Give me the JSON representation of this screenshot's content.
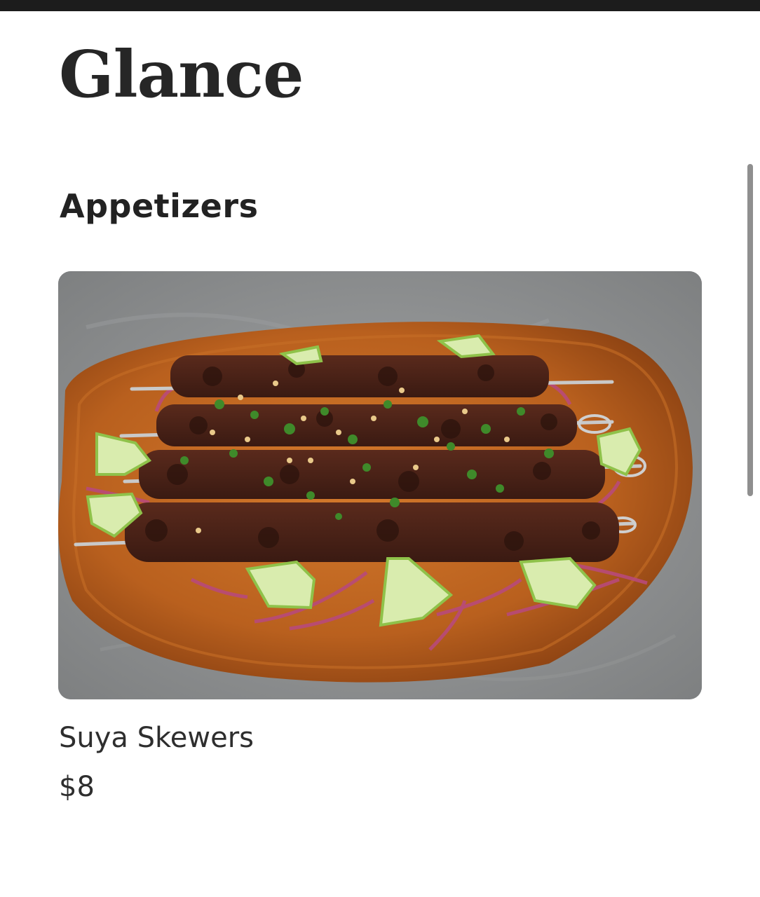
{
  "header": {
    "brand": "Glance"
  },
  "menu": {
    "section_title": "Appetizers",
    "items": [
      {
        "name": "Suya Skewers",
        "price": "$8",
        "image_icon": "grilled-skewers-photo"
      }
    ]
  },
  "colors": {
    "top_bar": "#1c1c1c",
    "text": "#2b2b2b",
    "scrollbar": "#8f8f8f"
  }
}
